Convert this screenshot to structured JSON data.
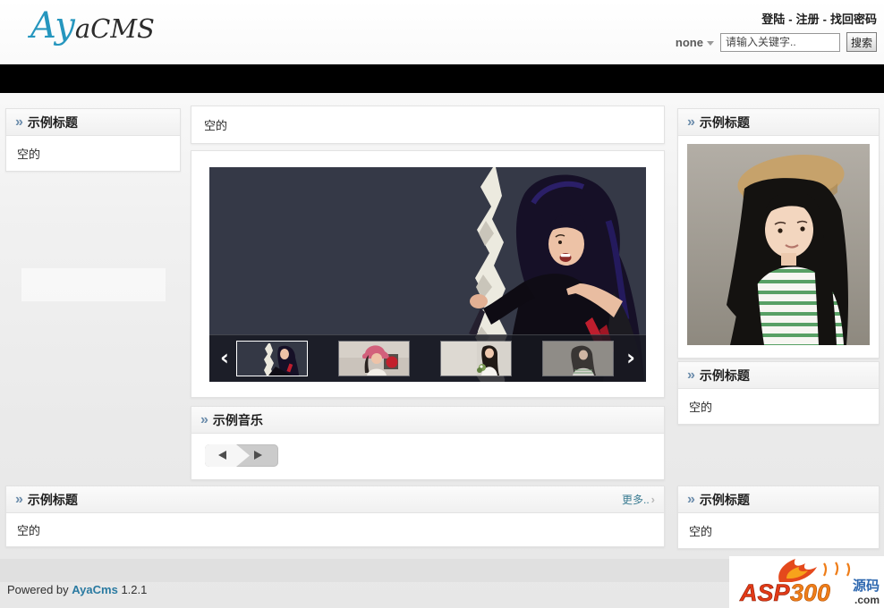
{
  "header": {
    "logo_blue": "Ay",
    "logo_dark": "aCMS",
    "links": {
      "login": "登陆",
      "register": "注册",
      "find_password": "找回密码",
      "separator": "-"
    },
    "search": {
      "scope": "none",
      "placeholder": "请输入关键字..",
      "button": "搜索"
    }
  },
  "sections": {
    "chevron": "»",
    "left_box": {
      "title": "示例标题",
      "content": "空的"
    },
    "main_empty": {
      "content": "空的"
    },
    "music": {
      "title": "示例音乐"
    },
    "right_box1": {
      "title": "示例标题"
    },
    "right_box2": {
      "title": "示例标题",
      "content": "空的"
    },
    "right_box3": {
      "title": "示例标题",
      "content": "空的"
    },
    "bottom_box": {
      "title": "示例标题",
      "more": "更多..",
      "more_arrow": "›",
      "content": "空的"
    }
  },
  "carousel": {
    "prev": "‹",
    "next": "›"
  },
  "footer": {
    "powered_prefix": "Powered by",
    "cms_name": "AyaCms",
    "version": "1.2.1",
    "watermark": {
      "asp": "ASP",
      "num": "300",
      "cn": "源码",
      "com": ".com"
    }
  },
  "colors": {
    "logo_blue": "#2596be",
    "section_chevron": "#6b8cab",
    "more_link": "#3c7d93",
    "footer_link": "#2a7aa1",
    "navbar": "#000000",
    "stage_background": "#353947"
  }
}
